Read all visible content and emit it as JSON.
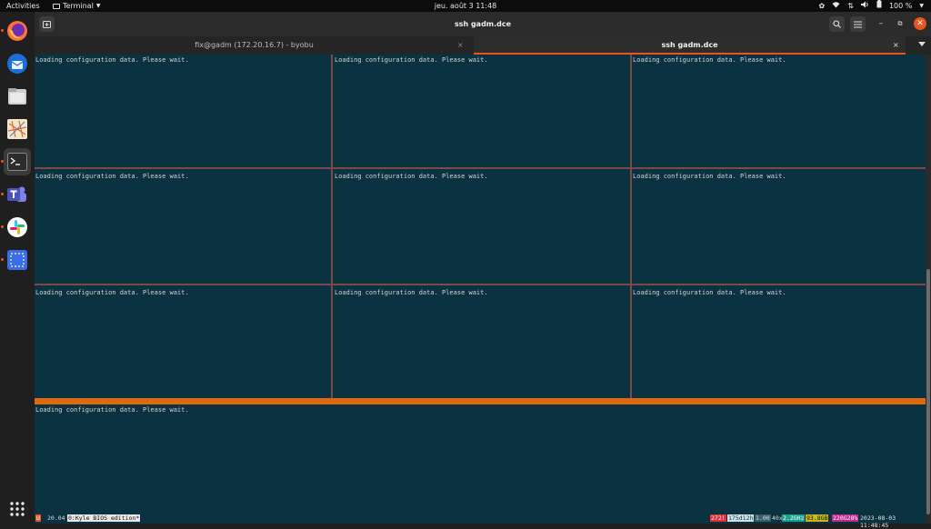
{
  "topbar": {
    "activities": "Activities",
    "app_name": "Terminal",
    "clock": "jeu. août 3  11:48",
    "battery": "100 %"
  },
  "dock": {
    "apps": [
      "firefox-icon",
      "thunderbird-icon",
      "files-icon",
      "maps-icon",
      "terminal-icon",
      "teams-icon",
      "slack-icon",
      "screenshot-icon"
    ],
    "show_apps": "show-applications-icon"
  },
  "window": {
    "title": "ssh gadm.dce",
    "tabs": [
      {
        "label": "fix@gadm (172.20.16.7) - byobu",
        "close": "×"
      },
      {
        "label": "ssh gadm.dce",
        "close": "×"
      }
    ]
  },
  "terminal": {
    "pane_text": "Loading configuration data. Please wait.",
    "panes": [
      {
        "text": "Loading configuration data. Please wait."
      },
      {
        "text": "Loading configuration data. Please wait."
      },
      {
        "text": "Loading configuration data. Please wait."
      },
      {
        "text": "Loading configuration data. Please wait."
      },
      {
        "text": "Loading configuration data. Please wait."
      },
      {
        "text": "Loading configuration data. Please wait."
      },
      {
        "text": "Loading configuration data. Please wait."
      },
      {
        "text": "Loading configuration data. Please wait."
      },
      {
        "text": "Loading configuration data. Please wait."
      },
      {
        "text": "Loading configuration data. Please wait."
      }
    ]
  },
  "statusline": {
    "logo": "U",
    "version": "20.04",
    "session": "0:Kyle BIOS edition*",
    "seg1": "272!",
    "seg2": "175d12h",
    "seg3": "1.00",
    "seg4_pre": "40x",
    "seg4": "2.2GHz",
    "seg5": "93.8GB",
    "seg6": "220G28%",
    "datetime": "2023-08-03 11:48:45"
  },
  "colors": {
    "accent": "#e95420",
    "terminal_bg": "#0a3240",
    "tmux_active_bar": "#dd6a0e"
  }
}
